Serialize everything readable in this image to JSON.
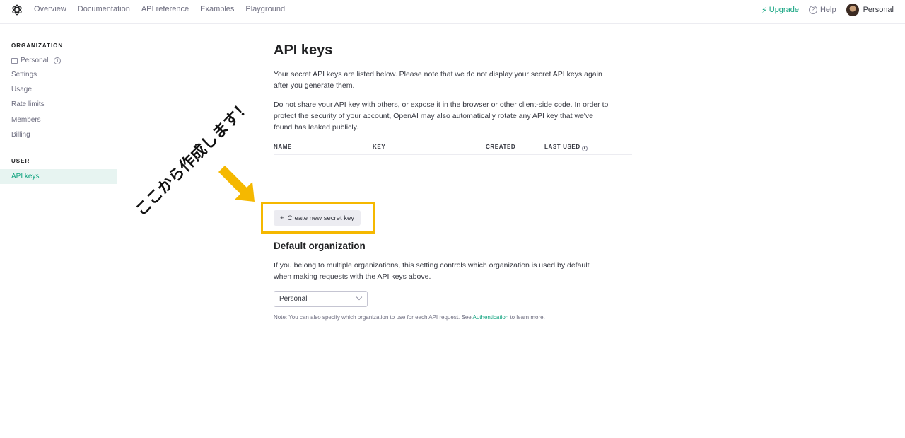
{
  "nav": {
    "links": [
      "Overview",
      "Documentation",
      "API reference",
      "Examples",
      "Playground"
    ],
    "upgrade": "Upgrade",
    "help": "Help",
    "profile": "Personal"
  },
  "sidebar": {
    "org_header": "ORGANIZATION",
    "org_name": "Personal",
    "org_items": [
      "Settings",
      "Usage",
      "Rate limits",
      "Members",
      "Billing"
    ],
    "user_header": "USER",
    "user_items": [
      "API keys"
    ]
  },
  "main": {
    "title": "API keys",
    "intro_line1": "Your secret API keys are listed below. Please note that we do not display your secret API keys again",
    "intro_line2": "after you generate them.",
    "warn_line1": "Do not share your API key with others, or expose it in the browser or other client-side code. In order to",
    "warn_line2": "protect the security of your account, OpenAI may also automatically rotate any API key that we've",
    "warn_line3": "found has leaked publicly.",
    "table_columns": [
      "NAME",
      "KEY",
      "CREATED",
      "LAST USED"
    ],
    "create_button": "Create new secret key",
    "default_org_title": "Default organization",
    "default_org_line1": "If you belong to multiple organizations, this setting controls which organization is used by default",
    "default_org_line2": "when making requests with the API keys above.",
    "select_value": "Personal",
    "note_prefix": "Note: You can also specify which organization to use for each API request. See ",
    "note_link": "Authentication",
    "note_suffix": " to learn more."
  },
  "annotation": {
    "text": "ここから作成します！",
    "highlight_color": "#f5b800"
  },
  "colors": {
    "accent": "#10a37f",
    "active_bg": "#e7f4f1"
  }
}
